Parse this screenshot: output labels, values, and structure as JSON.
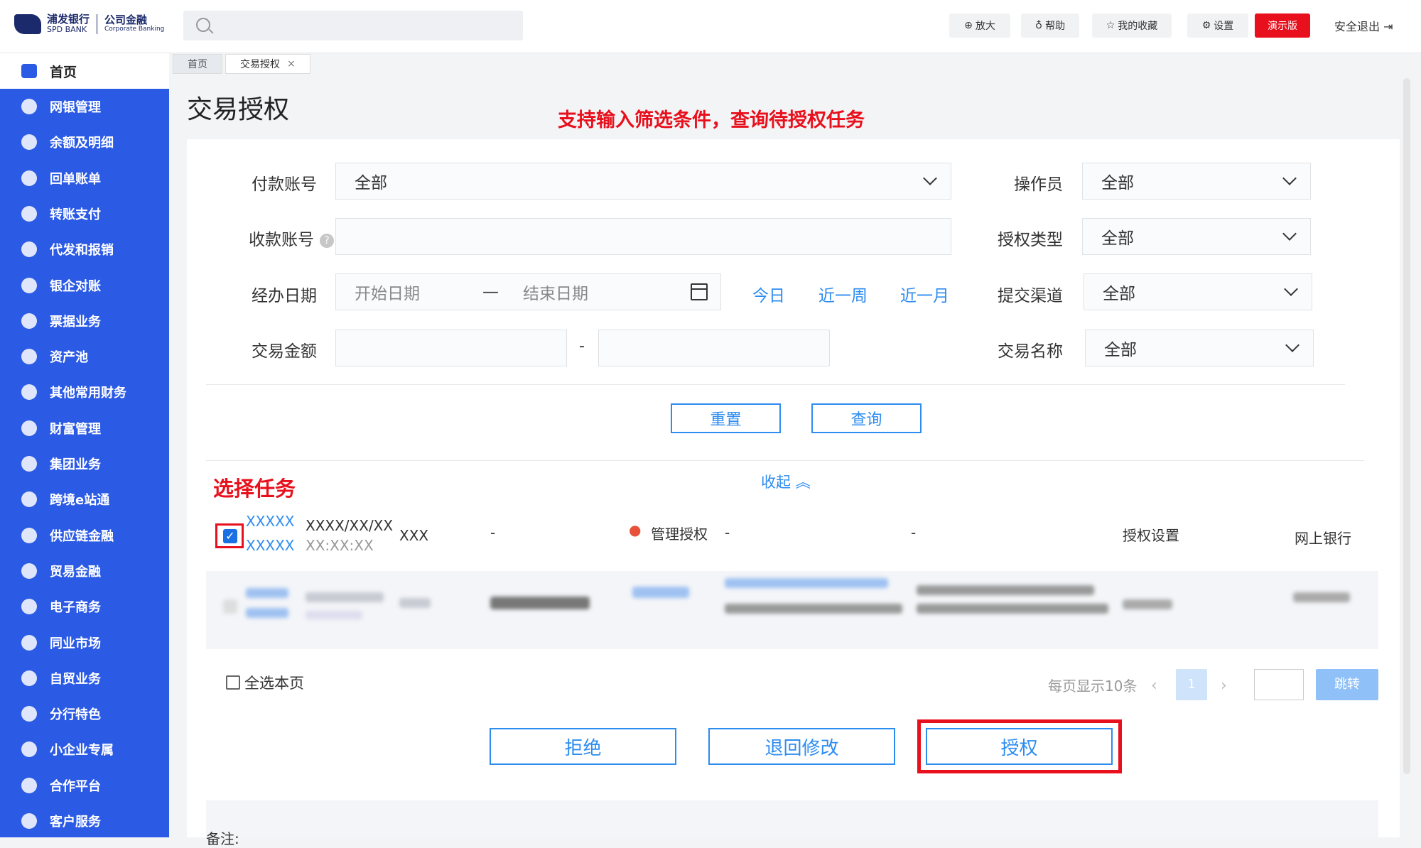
{
  "topbar": {
    "logo_cn": "浦发银行",
    "logo_en": "SPD BANK",
    "logo_sub_cn": "公司金融",
    "logo_sub_en": "Corporate Banking",
    "zoom": "放大",
    "help": "帮助",
    "favorites": "我的收藏",
    "settings": "设置",
    "demo": "演示版",
    "logout": "安全退出"
  },
  "sidebar": {
    "home": "首页",
    "items": [
      "网银管理",
      "余额及明细",
      "回单账单",
      "转账支付",
      "代发和报销",
      "银企对账",
      "票据业务",
      "资产池",
      "其他常用财务",
      "财富管理",
      "集团业务",
      "跨境e站通",
      "供应链金融",
      "贸易金融",
      "电子商务",
      "同业市场",
      "自贸业务",
      "分行特色",
      "小企业专属",
      "合作平台",
      "客户服务"
    ]
  },
  "tabs": [
    {
      "label": "首页"
    },
    {
      "label": "交易授权",
      "close": "×"
    }
  ],
  "page_title": "交易授权",
  "annotations": {
    "filter_note": "支持输入筛选条件，查询待授权任务",
    "select_note": "选择任务"
  },
  "filters": {
    "pay_account_label": "付款账号",
    "pay_account_value": "全部",
    "operator_label": "操作员",
    "operator_value": "全部",
    "recv_account_label": "收款账号",
    "auth_type_label": "授权类型",
    "auth_type_value": "全部",
    "date_label": "经办日期",
    "start_placeholder": "开始日期",
    "date_sep": "—",
    "end_placeholder": "结束日期",
    "today": "今日",
    "week": "近一周",
    "month": "近一月",
    "channel_label": "提交渠道",
    "channel_value": "全部",
    "amount_label": "交易金额",
    "amount_sep": "-",
    "txn_name_label": "交易名称",
    "txn_name_value": "全部",
    "help_icon": "?",
    "reset": "重置",
    "query": "查询",
    "collapse": "收起"
  },
  "task_row": {
    "id_line1": "XXXXX",
    "id_line2": "XXXXX",
    "date": "XXXX/XX/XX",
    "time": "XX:XX:XX",
    "col3": "XXX",
    "col4": "-",
    "auth_mode": "管理授权",
    "col6": "-",
    "col7": "-",
    "col8": "授权设置",
    "channel": "网上银行"
  },
  "footer": {
    "select_page": "全选本页",
    "per_page": "每页显示10条",
    "prev": "‹",
    "current_page": "1",
    "next": "›",
    "jump": "跳转",
    "reject": "拒绝",
    "return_edit": "退回修改",
    "authorize": "授权",
    "remark": "备注:"
  }
}
